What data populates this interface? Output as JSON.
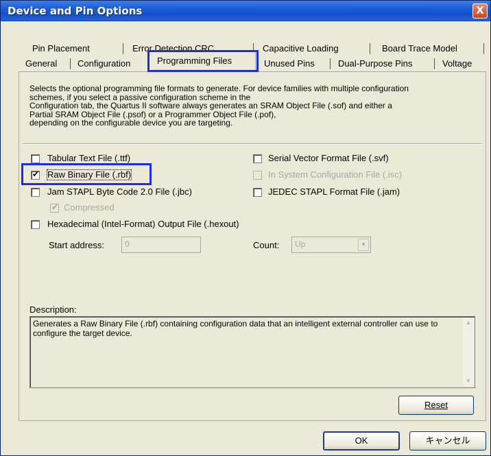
{
  "window": {
    "title": "Device and Pin Options",
    "close_label": "X"
  },
  "tabs": {
    "row1": [
      "Pin Placement",
      "Error Detection CRC",
      "Capacitive Loading",
      "Board Trace Model"
    ],
    "row2": [
      "General",
      "Configuration",
      "Programming Files",
      "Unused Pins",
      "Dual-Purpose Pins",
      "Voltage"
    ],
    "active": "Programming Files"
  },
  "intro": {
    "lines": [
      "Selects the optional programming file formats to generate. For device families with multiple configuration",
      "schemes, if you select a passive configuration scheme in the",
      "Configuration tab, the Quartus II software always generates an SRAM Object File (.sof) and either a",
      "Partial SRAM Object File (.psof) or a Programmer Object File (.pof),",
      "depending on the configurable device you are targeting."
    ]
  },
  "options": {
    "ttf": {
      "label": "Tabular Text File (.ttf)",
      "checked": false
    },
    "rbf": {
      "label": "Raw Binary File (.rbf)",
      "checked": true
    },
    "jbc": {
      "label": "Jam STAPL Byte Code 2.0 File (.jbc)",
      "checked": false
    },
    "compressed": {
      "label": "Compressed",
      "checked": true,
      "disabled": true
    },
    "hexout": {
      "label": "Hexadecimal (Intel-Format) Output File (.hexout)",
      "checked": false
    },
    "svf": {
      "label": "Serial Vector Format File (.svf)",
      "checked": false
    },
    "isc": {
      "label": "In System Configuration File (.isc)",
      "checked": false,
      "disabled": true
    },
    "jam": {
      "label": "JEDEC STAPL Format File (.jam)",
      "checked": false
    }
  },
  "hex": {
    "start_label": "Start address:",
    "start_value": "0",
    "count_label": "Count:",
    "count_value": "Up"
  },
  "description": {
    "label": "Description:",
    "text": "Generates a Raw Binary File (.rbf) containing configuration data that an intelligent external controller can use to configure the target device."
  },
  "buttons": {
    "reset": "Reset",
    "ok": "OK",
    "cancel": "キャンセル"
  },
  "colors": {
    "titlebar": "#1c5bd6",
    "highlight": "#1a2fd6",
    "dialog_bg": "#ece9d8"
  }
}
